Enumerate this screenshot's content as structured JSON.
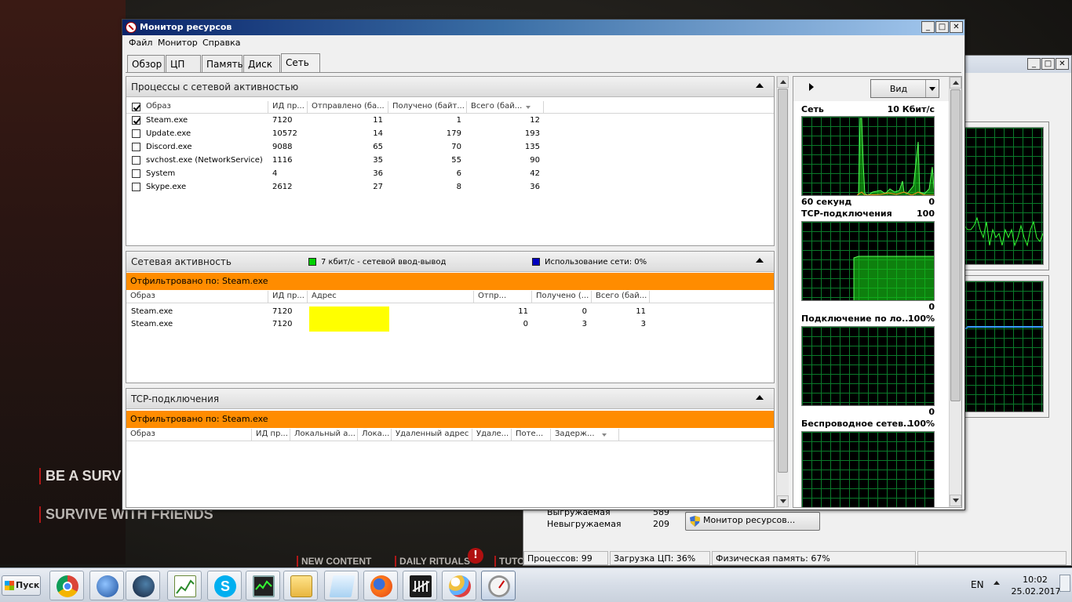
{
  "background": {
    "tagline_1": "BE A SURVI",
    "tagline_2": "SURVIVE WITH FRIENDS",
    "nav": [
      "NEW CONTENT",
      "DAILY RITUALS",
      "TUTO"
    ],
    "alert_badge": "!"
  },
  "task_manager": {
    "paged_label": "Выгружаемая",
    "paged_value": "589",
    "nonpaged_label": "Невыгружаемая",
    "nonpaged_value": "209",
    "resource_monitor_button": "Монитор ресурсов...",
    "status": {
      "processes": "Процессов: 99",
      "cpu": "Загрузка ЦП: 36%",
      "memory": "Физическая память: 67%"
    }
  },
  "window": {
    "title": "Монитор ресурсов",
    "caption_buttons": {
      "minimize": "_",
      "maximize": "□",
      "close": "✕"
    },
    "menu": [
      "Файл",
      "Монитор",
      "Справка"
    ],
    "tabs": [
      "Обзор",
      "ЦП",
      "Память",
      "Диск",
      "Сеть"
    ],
    "active_tab": "Сеть"
  },
  "processes_panel": {
    "title": "Процессы с сетевой активностью",
    "columns": [
      "Образ",
      "ИД пр...",
      "Отправлено (ба...",
      "Получено (байт...",
      "Всего (бай..."
    ],
    "rows": [
      {
        "name": "Steam.exe",
        "pid": "7120",
        "sent": "11",
        "recv": "1",
        "total": "12",
        "checked": true
      },
      {
        "name": "Update.exe",
        "pid": "10572",
        "sent": "14",
        "recv": "179",
        "total": "193",
        "checked": false
      },
      {
        "name": "Discord.exe",
        "pid": "9088",
        "sent": "65",
        "recv": "70",
        "total": "135",
        "checked": false
      },
      {
        "name": "svchost.exe (NetworkService)",
        "pid": "1116",
        "sent": "35",
        "recv": "55",
        "total": "90",
        "checked": false
      },
      {
        "name": "System",
        "pid": "4",
        "sent": "36",
        "recv": "6",
        "total": "42",
        "checked": false
      },
      {
        "name": "Skype.exe",
        "pid": "2612",
        "sent": "27",
        "recv": "8",
        "total": "36",
        "checked": false
      }
    ]
  },
  "network_panel": {
    "title": "Сетевая активность",
    "legend_io": "7 кбит/с - сетевой ввод-вывод",
    "legend_io_color": "#00d000",
    "legend_usage": "Использование сети: 0%",
    "legend_usage_color": "#0000c0",
    "filter": "Отфильтровано по: Steam.exe",
    "columns": [
      "Образ",
      "ИД пр...",
      "Адрес",
      "Отпр...",
      "Получено (...",
      "Всего (бай..."
    ],
    "rows": [
      {
        "name": "Steam.exe",
        "pid": "7120",
        "address": "",
        "sent": "11",
        "recv": "0",
        "total": "11"
      },
      {
        "name": "Steam.exe",
        "pid": "7120",
        "address": "",
        "sent": "0",
        "recv": "3",
        "total": "3"
      }
    ],
    "redaction_color": "#ffff00"
  },
  "tcp_panel": {
    "title": "TCP-подключения",
    "filter": "Отфильтровано по: Steam.exe",
    "columns": [
      "Образ",
      "ИД пр...",
      "Локальный а...",
      "Лока...",
      "Удаленный адрес",
      "Удале...",
      "Поте...",
      "Задерж..."
    ]
  },
  "graphs": {
    "view_button": "Вид",
    "items": [
      {
        "title": "Сеть",
        "max": "10 Кбит/с",
        "footer_left": "60 секунд",
        "footer_right": "0"
      },
      {
        "title": "TCP-подключения",
        "max": "100",
        "footer_left": "",
        "footer_right": "0"
      },
      {
        "title": "Подключение по ло...",
        "max": "100%",
        "footer_left": "",
        "footer_right": "0"
      },
      {
        "title": "Беспроводное сетев...",
        "max": "100%",
        "footer_left": "",
        "footer_right": ""
      }
    ]
  },
  "taskbar": {
    "start_label": "Пуск",
    "apps": [
      "chrome-icon",
      "thunderbird-icon",
      "steam-icon",
      "graph-editor-icon",
      "skype-icon",
      "system-monitor-icon",
      "explorer-folder-icon",
      "notepad-icon",
      "firefox-icon",
      "dead-by-daylight-icon",
      "paint-icon",
      "resource-monitor-icon"
    ],
    "language": "EN",
    "time": "10:02",
    "date": "25.02.2017"
  }
}
